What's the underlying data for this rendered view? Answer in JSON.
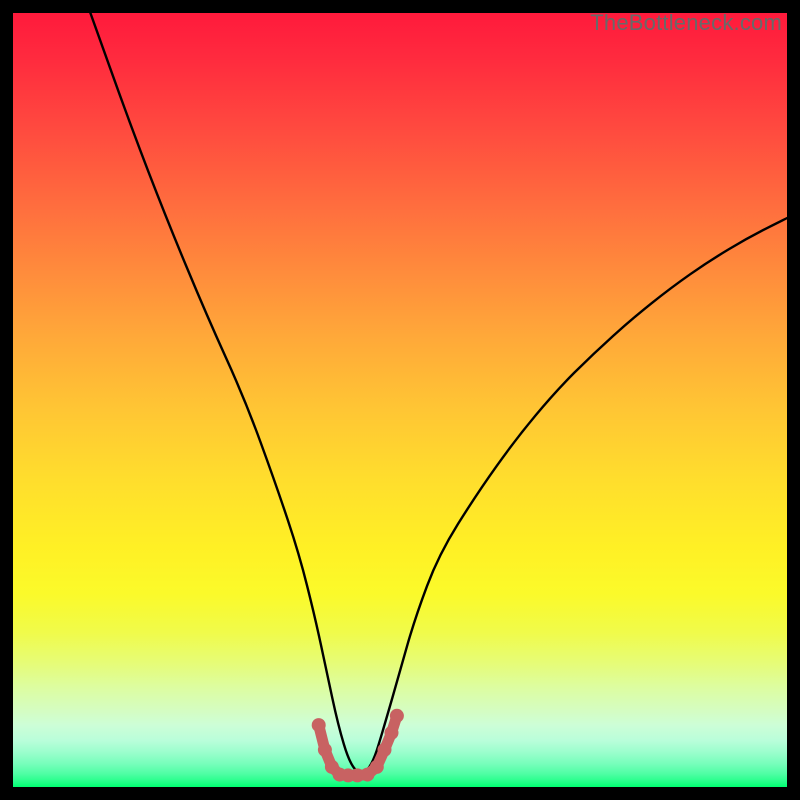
{
  "attribution": "TheBottleneck.com",
  "colors": {
    "page_bg": "#000000",
    "curve_stroke": "#000000",
    "marker_stroke": "#c86262",
    "marker_fill": "#c86262",
    "attribution_text": "#696969"
  },
  "chart_data": {
    "type": "line",
    "title": "",
    "xlabel": "",
    "ylabel": "",
    "xlim": [
      0,
      100
    ],
    "ylim": [
      0,
      100
    ],
    "series": [
      {
        "name": "curve",
        "x": [
          10,
          15,
          20,
          25,
          30,
          34,
          37,
          39,
          40.5,
          42,
          43.5,
          45,
          46.5,
          48,
          50,
          52,
          55,
          60,
          65,
          70,
          75,
          80,
          85,
          90,
          95,
          100
        ],
        "y": [
          100,
          86,
          73,
          61,
          50,
          39,
          30,
          22,
          15,
          8,
          3,
          1.5,
          3,
          8,
          15,
          22,
          30,
          38,
          45,
          51,
          56,
          60.5,
          64.5,
          68,
          71,
          73.5
        ]
      },
      {
        "name": "highlight",
        "x": [
          39.5,
          40.3,
          41.2,
          42.2,
          43.3,
          44.5,
          45.8,
          47.0,
          48.0,
          48.9,
          49.6
        ],
        "y": [
          8.0,
          4.8,
          2.6,
          1.6,
          1.5,
          1.5,
          1.6,
          2.6,
          4.8,
          7.0,
          9.2
        ]
      }
    ]
  }
}
